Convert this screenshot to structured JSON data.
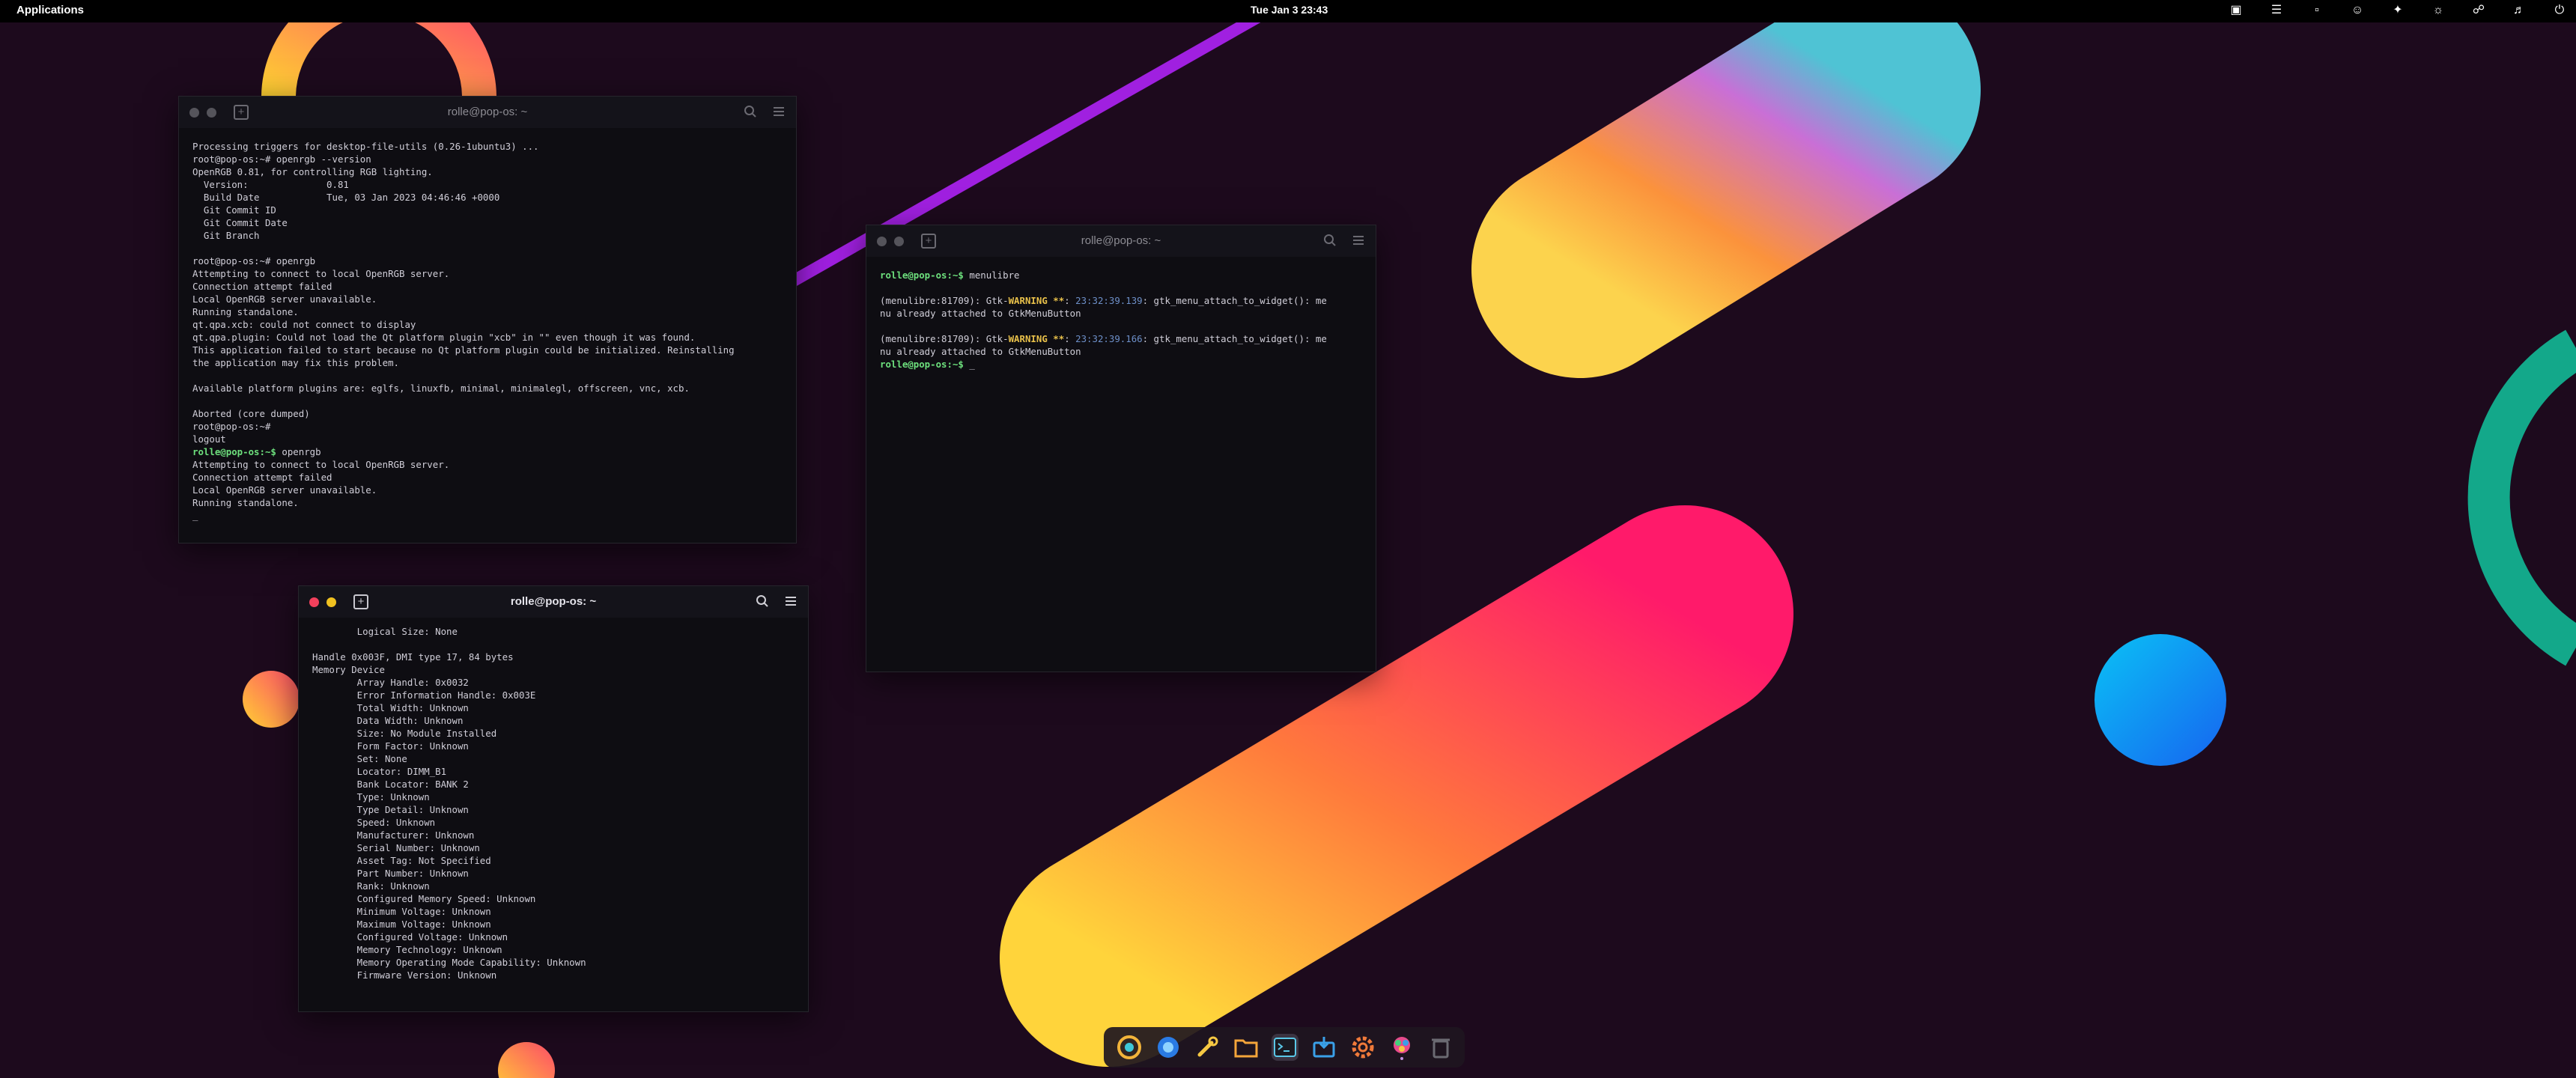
{
  "topbar": {
    "applications_label": "Applications",
    "clock": "Tue Jan 3  23:43"
  },
  "windows": {
    "term1": {
      "title": "rolle@pop-os: ~",
      "lines": [
        {
          "t": "Processing triggers for desktop-file-utils (0.26-1ubuntu3) ..."
        },
        {
          "t": "root@pop-os:~# openrgb --version"
        },
        {
          "t": "OpenRGB 0.81, for controlling RGB lighting."
        },
        {
          "t": "  Version:              0.81"
        },
        {
          "t": "  Build Date            Tue, 03 Jan 2023 04:46:46 +0000"
        },
        {
          "t": "  Git Commit ID"
        },
        {
          "t": "  Git Commit Date"
        },
        {
          "t": "  Git Branch"
        },
        {
          "t": ""
        },
        {
          "t": "root@pop-os:~# openrgb"
        },
        {
          "t": "Attempting to connect to local OpenRGB server."
        },
        {
          "t": "Connection attempt failed"
        },
        {
          "t": "Local OpenRGB server unavailable."
        },
        {
          "t": "Running standalone."
        },
        {
          "t": "qt.qpa.xcb: could not connect to display"
        },
        {
          "t": "qt.qpa.plugin: Could not load the Qt platform plugin \"xcb\" in \"\" even though it was found."
        },
        {
          "t": "This application failed to start because no Qt platform plugin could be initialized. Reinstalling"
        },
        {
          "t": "the application may fix this problem."
        },
        {
          "t": ""
        },
        {
          "t": "Available platform plugins are: eglfs, linuxfb, minimal, minimalegl, offscreen, vnc, xcb."
        },
        {
          "t": ""
        },
        {
          "t": "Aborted (core dumped)"
        },
        {
          "t": "root@pop-os:~#"
        },
        {
          "t": "logout"
        },
        {
          "p": "rolle@pop-os:~$",
          "t": " openrgb"
        },
        {
          "t": "Attempting to connect to local OpenRGB server."
        },
        {
          "t": "Connection attempt failed"
        },
        {
          "t": "Local OpenRGB server unavailable."
        },
        {
          "t": "Running standalone."
        },
        {
          "t": "_"
        }
      ]
    },
    "term2": {
      "title": "rolle@pop-os: ~",
      "lines": [
        {
          "p": "rolle@pop-os:~$",
          "t": " menulibre"
        },
        {
          "t": ""
        },
        {
          "t": "(menulibre:81709): Gtk-",
          "w": "WARNING **",
          "t2": ": ",
          "ts": "23:32:39.139",
          "t3": ": gtk_menu_attach_to_widget(): me"
        },
        {
          "t": "nu already attached to GtkMenuButton"
        },
        {
          "t": ""
        },
        {
          "t": "(menulibre:81709): Gtk-",
          "w": "WARNING **",
          "t2": ": ",
          "ts": "23:32:39.166",
          "t3": ": gtk_menu_attach_to_widget(): me"
        },
        {
          "t": "nu already attached to GtkMenuButton"
        },
        {
          "p": "rolle@pop-os:~$",
          "t": " _"
        }
      ]
    },
    "term3": {
      "title": "rolle@pop-os: ~",
      "lines": [
        {
          "t": "        Logical Size: None"
        },
        {
          "t": ""
        },
        {
          "t": "Handle 0x003F, DMI type 17, 84 bytes"
        },
        {
          "t": "Memory Device"
        },
        {
          "t": "        Array Handle: 0x0032"
        },
        {
          "t": "        Error Information Handle: 0x003E"
        },
        {
          "t": "        Total Width: Unknown"
        },
        {
          "t": "        Data Width: Unknown"
        },
        {
          "t": "        Size: No Module Installed"
        },
        {
          "t": "        Form Factor: Unknown"
        },
        {
          "t": "        Set: None"
        },
        {
          "t": "        Locator: DIMM_B1"
        },
        {
          "t": "        Bank Locator: BANK 2"
        },
        {
          "t": "        Type: Unknown"
        },
        {
          "t": "        Type Detail: Unknown"
        },
        {
          "t": "        Speed: Unknown"
        },
        {
          "t": "        Manufacturer: Unknown"
        },
        {
          "t": "        Serial Number: Unknown"
        },
        {
          "t": "        Asset Tag: Not Specified"
        },
        {
          "t": "        Part Number: Unknown"
        },
        {
          "t": "        Rank: Unknown"
        },
        {
          "t": "        Configured Memory Speed: Unknown"
        },
        {
          "t": "        Minimum Voltage: Unknown"
        },
        {
          "t": "        Maximum Voltage: Unknown"
        },
        {
          "t": "        Configured Voltage: Unknown"
        },
        {
          "t": "        Memory Technology: Unknown"
        },
        {
          "t": "        Memory Operating Mode Capability: Unknown"
        },
        {
          "t": "        Firmware Version: Unknown"
        }
      ]
    }
  },
  "dock": {
    "items": [
      {
        "icon": "launcher-icon"
      },
      {
        "icon": "browser-icon"
      },
      {
        "icon": "tools-icon"
      },
      {
        "icon": "files-icon"
      },
      {
        "icon": "terminal-icon"
      },
      {
        "icon": "store-icon"
      },
      {
        "icon": "settings-icon"
      },
      {
        "icon": "color-picker-icon"
      },
      {
        "icon": "trash-icon"
      }
    ]
  },
  "tray": {
    "icons": [
      "system-icon",
      "notes-icon",
      "clipboard-icon",
      "emoji-icon",
      "extensions-icon",
      "brightness-icon",
      "network-icon",
      "volume-icon",
      "power-icon"
    ]
  }
}
